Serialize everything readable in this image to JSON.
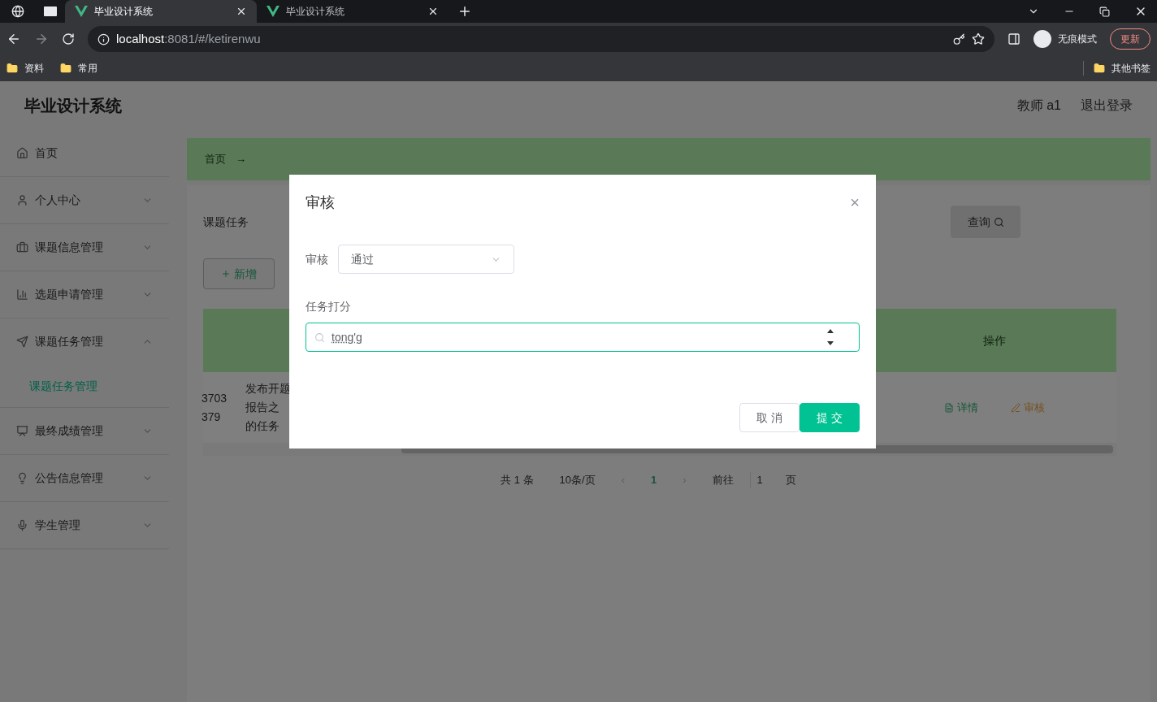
{
  "browser": {
    "tabs": [
      {
        "title": "毕业设计系统",
        "selected": true
      },
      {
        "title": "毕业设计系统",
        "selected": false
      }
    ],
    "url": {
      "host": "localhost",
      "rest": ":8081/#/ketirenwu"
    },
    "profile": "无痕模式",
    "update_button": "更新",
    "bookmarks": [
      "资料",
      "常用"
    ],
    "other_bookmarks": "其他书签"
  },
  "header": {
    "title": "毕业设计系统",
    "user": "教师 a1",
    "logout": "退出登录"
  },
  "sidebar": {
    "items": [
      {
        "label": "首页",
        "kind": "link"
      },
      {
        "label": "个人中心",
        "kind": "menu",
        "expanded": false
      },
      {
        "label": "课题信息管理",
        "kind": "menu",
        "expanded": false
      },
      {
        "label": "选题申请管理",
        "kind": "menu",
        "expanded": false
      },
      {
        "label": "课题任务管理",
        "kind": "menu",
        "expanded": true,
        "children": [
          {
            "label": "课题任务管理",
            "selected": true
          }
        ]
      },
      {
        "label": "最终成绩管理",
        "kind": "menu",
        "expanded": false
      },
      {
        "label": "公告信息管理",
        "kind": "menu",
        "expanded": false
      },
      {
        "label": "学生管理",
        "kind": "menu",
        "expanded": false
      }
    ]
  },
  "breadcrumb": {
    "home": "首页",
    "separator": "→"
  },
  "search": {
    "label": "课题任务",
    "button": "查询"
  },
  "add_button": "新增",
  "table": {
    "action_column": "操作",
    "rows": [
      {
        "id_lines": [
          "3703",
          "379"
        ],
        "task_lines": [
          "发布开题",
          "报告之",
          "的任务"
        ],
        "actions": [
          "详情",
          "审核"
        ]
      }
    ]
  },
  "pagination": {
    "total": "共 1 条",
    "page_size": "10条/页",
    "prev": "‹",
    "pages": [
      {
        "label": "1",
        "selected": true
      }
    ],
    "next": "›",
    "goto": "前往",
    "goto_value": "1",
    "page_suffix": "页"
  },
  "dialog": {
    "title": "审核",
    "close": "×",
    "fields": [
      {
        "kind": "select",
        "label": "审核",
        "value": "通过"
      },
      {
        "kind": "number",
        "label": "任务打分",
        "value": "tong'g",
        "focused": true
      }
    ],
    "buttons": [
      {
        "label": "取 消",
        "kind": "cancel"
      },
      {
        "label": "提 交",
        "kind": "primary"
      }
    ]
  }
}
